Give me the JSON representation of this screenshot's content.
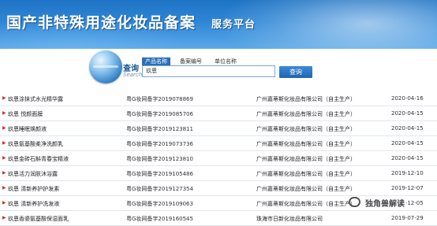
{
  "banner": {
    "title": "国产非特殊用途化妆品备案",
    "subtitle": "服务平台"
  },
  "search": {
    "label": "查询",
    "label_en": "Search",
    "tabs": [
      {
        "label": "产品名称",
        "active": true
      },
      {
        "label": "备案编号",
        "active": false
      },
      {
        "label": "单位名称",
        "active": false
      }
    ],
    "input_value": "玖恩",
    "button_label": "查询"
  },
  "rows": [
    {
      "name": "玖恩涂抹式水光精华露",
      "reg": "粤G妆网备字2019078869",
      "company": "广州嘉蒂斯化妆品有限公司（自主生产）",
      "date": "2020-04-16"
    },
    {
      "name": "玖恩 悦颜面膜",
      "reg": "粤G妆网备字2019085706",
      "company": "广州嘉蒂斯化妆品有限公司（自主生产）",
      "date": "2020-04-15"
    },
    {
      "name": "玖恩睡眠焕颜液",
      "reg": "粤G妆网备字2019123811",
      "company": "广州嘉蒂斯化妆品有限公司（自主生产）",
      "date": "2020-04-15"
    },
    {
      "name": "玖恩氨基酸柔净洗颜乳",
      "reg": "粤G妆网备字2019073736",
      "company": "广州嘉蒂斯化妆品有限公司（自主生产）",
      "date": "2020-04-15"
    },
    {
      "name": "玖恩金砖石斛青春宝精液",
      "reg": "粤G妆网备字2019123810",
      "company": "广州嘉蒂斯化妆品有限公司（自主生产）",
      "date": "2020-04-15"
    },
    {
      "name": "玖恩活力润肤沐浴露",
      "reg": "粤G妆网备字2019105486",
      "company": "广州嘉蒂斯化妆品有限公司（自主生产）",
      "date": "2019-12-10"
    },
    {
      "name": "玖恩 清新养护护发素",
      "reg": "粤G妆网备字2019127354",
      "company": "广州嘉蒂斯化妆品有限公司（自主生产）",
      "date": "2019-12-07"
    },
    {
      "name": "玖恩 清新养护洗发液",
      "reg": "粤G妆网备字2019109063",
      "company": "广州嘉蒂斯化妆品有限公司（自主生产）",
      "date": "2019-12-05"
    },
    {
      "name": "玖恩香婆氨基酸保湿面乳",
      "reg": "粤G妆网备字2019160545",
      "company": "珠海市日新化妆品有限公司",
      "date": "2019-07-29"
    }
  ],
  "watermark": {
    "text": "独角兽解读",
    "icon": "chat-bubble-icon"
  },
  "colors": {
    "banner_top": "#1e73c4",
    "banner_bottom": "#5aa8e8",
    "tab_active": "#2a6fb8",
    "button": "#1f64b0",
    "row_arrow": "#c0392b"
  }
}
